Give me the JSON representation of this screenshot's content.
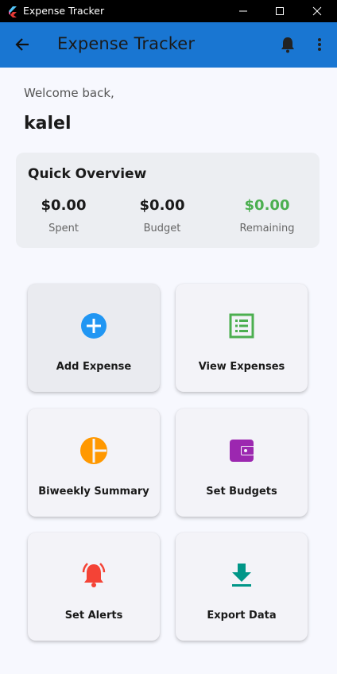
{
  "window": {
    "title": "Expense Tracker"
  },
  "appbar": {
    "title": "Expense Tracker",
    "back_icon": "arrow-back-icon",
    "notification_icon": "bell-icon",
    "menu_icon": "more-vert-icon"
  },
  "greeting": {
    "welcome": "Welcome back,",
    "username": "kalel"
  },
  "overview": {
    "title": "Quick Overview",
    "stats": [
      {
        "value": "$0.00",
        "label": "Spent"
      },
      {
        "value": "$0.00",
        "label": "Budget"
      },
      {
        "value": "$0.00",
        "label": "Remaining",
        "color": "#4caf50"
      }
    ]
  },
  "tiles": [
    {
      "label": "Add Expense",
      "icon": "add-circle-icon",
      "color": "#2196f3"
    },
    {
      "label": "View Expenses",
      "icon": "list-alt-icon",
      "color": "#4caf50"
    },
    {
      "label": "Biweekly Summary",
      "icon": "pie-chart-icon",
      "color": "#ff9800"
    },
    {
      "label": "Set Budgets",
      "icon": "wallet-icon",
      "color": "#9c27b0"
    },
    {
      "label": "Set Alerts",
      "icon": "alarm-icon",
      "color": "#f44336"
    },
    {
      "label": "Export Data",
      "icon": "download-icon",
      "color": "#009688"
    }
  ],
  "colors": {
    "appbar": "#1976d2",
    "background": "#f7f8fe",
    "card": "#eceef2"
  }
}
